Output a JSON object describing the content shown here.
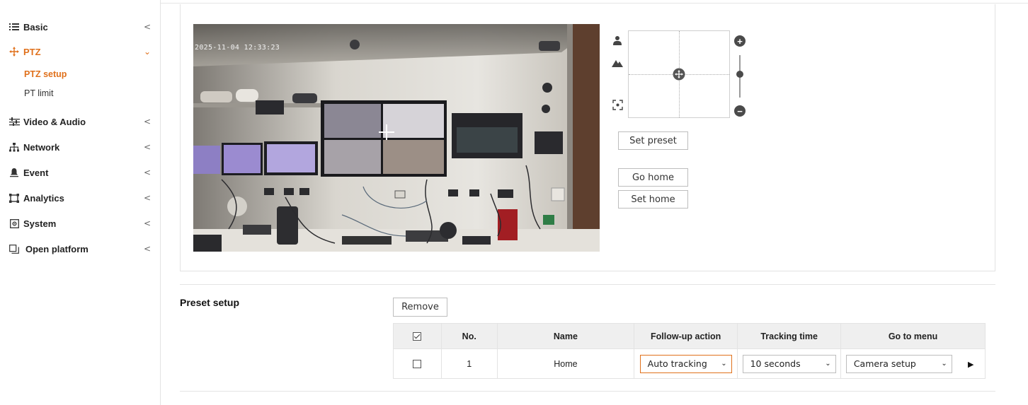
{
  "sidebar": {
    "items": [
      {
        "label": "Basic",
        "icon": "list-icon",
        "chevron": "<"
      },
      {
        "label": "PTZ",
        "icon": "move-icon",
        "chevron": "⌄"
      },
      {
        "label": "Video & Audio",
        "icon": "sliders-icon",
        "chevron": "<"
      },
      {
        "label": "Network",
        "icon": "network-icon",
        "chevron": "<"
      },
      {
        "label": "Event",
        "icon": "bell-icon",
        "chevron": "<"
      },
      {
        "label": "Analytics",
        "icon": "frame-icon",
        "chevron": "<"
      },
      {
        "label": "System",
        "icon": "system-icon",
        "chevron": "<"
      },
      {
        "label": "Open platform",
        "icon": "window-icon",
        "chevron": "<"
      }
    ],
    "ptz_sub": [
      {
        "label": "PTZ setup"
      },
      {
        "label": "PT limit"
      }
    ],
    "accent_color": "#e0711c"
  },
  "video": {
    "timestamp": "2025-11-04 12:33:23"
  },
  "ptz": {
    "set_preset": "Set preset",
    "go_home": "Go home",
    "set_home": "Set home",
    "zoom_in": "+",
    "zoom_out": "−",
    "zoom_level": 0.55
  },
  "preset_setup": {
    "title": "Preset setup",
    "remove_label": "Remove",
    "columns": [
      "No.",
      "Name",
      "Follow-up action",
      "Tracking time",
      "Go to menu"
    ],
    "rows": [
      {
        "no": "1",
        "name": "Home",
        "follow_up": "Auto tracking",
        "tracking_time": "10 seconds",
        "go_to_menu": "Camera setup"
      }
    ]
  }
}
